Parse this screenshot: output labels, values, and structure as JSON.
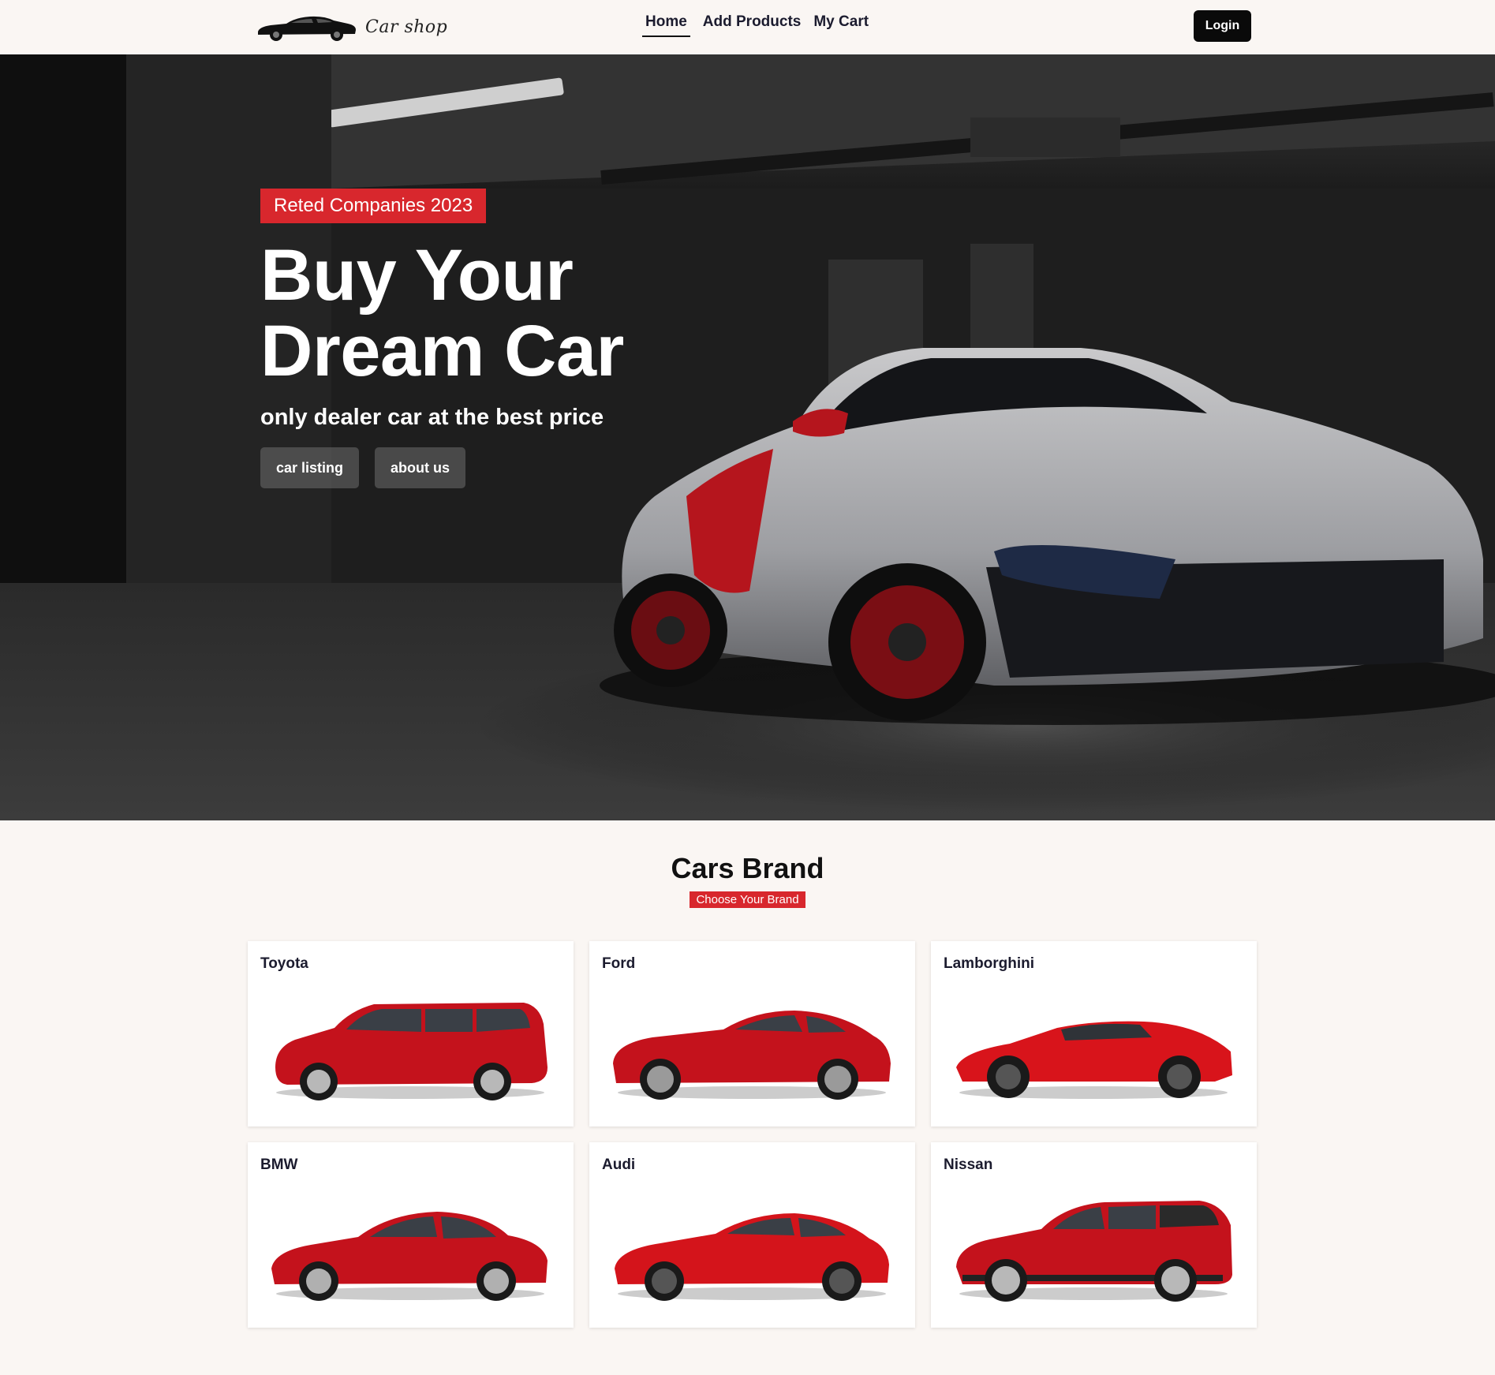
{
  "nav": {
    "brand_name": "Car shop",
    "links": [
      "Home",
      "Add Products",
      "My Cart"
    ],
    "active_link": "Home",
    "login_label": "Login"
  },
  "hero": {
    "badge": "Reted Companies 2023",
    "title": "Buy Your Dream Car",
    "subtitle": "only dealer car at the best price",
    "buttons": [
      "car listing",
      "about us"
    ]
  },
  "brands": {
    "title": "Cars Brand",
    "tag": "Choose Your Brand",
    "items": [
      {
        "name": "Toyota",
        "body": "minivan"
      },
      {
        "name": "Ford",
        "body": "coupe"
      },
      {
        "name": "Lamborghini",
        "body": "supercar"
      },
      {
        "name": "BMW",
        "body": "sedan"
      },
      {
        "name": "Audi",
        "body": "coupe"
      },
      {
        "name": "Nissan",
        "body": "suv"
      }
    ]
  },
  "colors": {
    "accent": "#d8272d",
    "background": "#faf6f3",
    "car_red": "#c4121c",
    "button_dark": "#0a0a0a"
  },
  "icons": [
    "car-logo-icon"
  ]
}
